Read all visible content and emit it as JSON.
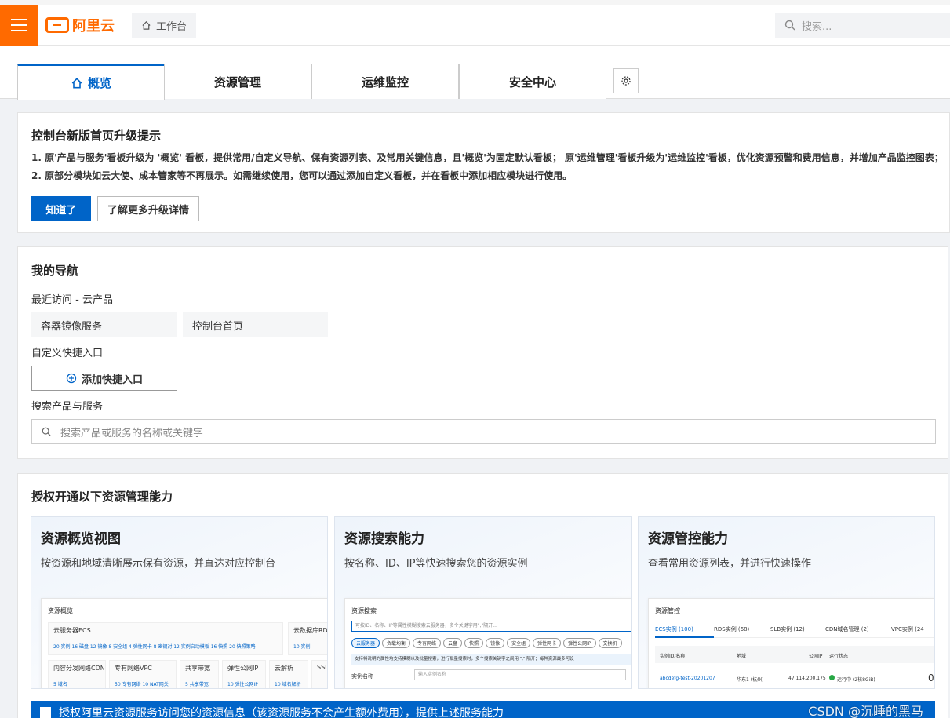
{
  "header": {
    "logo_text": "阿里云",
    "breadcrumb": "工作台",
    "search_placeholder": "搜索...",
    "brand_color": "#ff6a00"
  },
  "tabs": [
    {
      "label": "概览",
      "icon": "home-icon",
      "active": true
    },
    {
      "label": "资源管理",
      "active": false
    },
    {
      "label": "运维监控",
      "active": false
    },
    {
      "label": "安全中心",
      "active": false
    }
  ],
  "upgrade": {
    "title": "控制台新版首页升级提示",
    "line1": "1. 原'产品与服务'看板升级为 '概览' 看板，提供常用/自定义导航、保有资源列表、及常用关键信息，且'概览'为固定默认看板； 原'运维管理'看板升级为'运维监控'看板，优化资源预警和费用信息，并增加产品监控图表；",
    "line2": "2. 原部分模块如云大使、成本管家等不再展示。如需继续使用，您可以通过添加自定义看板，并在看板中添加相应模块进行使用。",
    "ok_label": "知道了",
    "more_label": "了解更多升级详情"
  },
  "nav": {
    "title": "我的导航",
    "recent_label": "最近访问 - 云产品",
    "recent_items": [
      "容器镜像服务",
      "控制台首页"
    ],
    "custom_label": "自定义快捷入口",
    "add_label": "添加快捷入口",
    "search_label": "搜索产品与服务",
    "search_placeholder": "搜索产品或服务的名称或关键字"
  },
  "auth": {
    "title": "授权开通以下资源管理能力",
    "features": [
      {
        "title": "资源概览视图",
        "desc": "按资源和地域清晰展示保有资源，并直达对应控制台"
      },
      {
        "title": "资源搜索能力",
        "desc": "按名称、ID、IP等快速搜索您的资源实例"
      },
      {
        "title": "资源管控能力",
        "desc": "查看常用资源列表，并进行快速操作"
      }
    ],
    "checkbox_label": "授权阿里云资源服务访问您的资源信息（该资源服务不会产生额外费用），提供上述服务能力"
  },
  "preview1": {
    "heading": "资源概览",
    "ecs": "云服务器ECS",
    "ecs_stats": "20 实例  16 磁盘  12 镜像  8 安全组  4 弹性网卡  8 密钥对  12 实例启动模板  16 快照  20 快照策略",
    "rds": "云数据库RDS",
    "rds_stats": "10 实例",
    "row2": [
      {
        "t": "内容分发网络CDN",
        "s": "5 域名"
      },
      {
        "t": "专有网络VPC",
        "s": "50 专有网络  10 NAT网关"
      },
      {
        "t": "共享带宽",
        "s": "5 共享带宽"
      },
      {
        "t": "弹性公网IP",
        "s": "10 弹性公网IP"
      },
      {
        "t": "云解析",
        "s": "10 域名解析"
      },
      {
        "t": "SSL",
        "s": ""
      }
    ]
  },
  "preview2": {
    "heading": "资源搜索",
    "search_hint": "可按ID、名称、IP等属性模糊搜索云服务器，多个关键字用\",\"隔开...",
    "pills": [
      "云服务器",
      "负载均衡",
      "专有网络",
      "云盘",
      "快照",
      "镜像",
      "安全组",
      "弹性网卡",
      "弹性公网IP",
      "交换机"
    ],
    "notice": "支持将说明的属性均支持模糊以及批量搜索，进行批量搜索时，多个搜索关键字之间用 \",\" 隔开；每种资源最多可设",
    "field_label": "实例名称",
    "field_placeholder": "输入实例名称"
  },
  "preview3": {
    "heading": "资源管控",
    "tabs": [
      "ECS实例 (100)",
      "RDS实例 (68)",
      "SLB实例 (12)",
      "CDN域名管理 (2)",
      "VPC实例 (24"
    ],
    "cols": [
      "实例ID/名称",
      "地域",
      "公网IP",
      "运行状态"
    ],
    "row": {
      "id": "abcdefg-test-20201207",
      "region": "华东1 (杭州)",
      "ip": "47.114.200.175",
      "status": "运行中 (2核8GiB)",
      "extra": "0"
    }
  },
  "watermark": "CSDN @沉睡的黑马"
}
